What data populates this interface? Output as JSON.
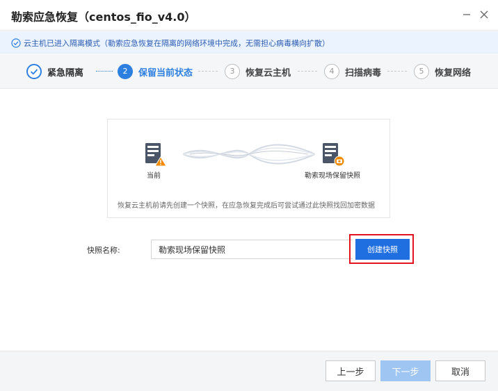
{
  "window": {
    "title": "勒索应急恢复（centos_fio_v4.0）"
  },
  "info_bar": {
    "text": "云主机已进入隔离模式（勒索应急恢复在隔离的网络环境中完成，无需担心病毒横向扩散）"
  },
  "steps": [
    {
      "number": "",
      "label": "紧急隔离",
      "state": "done"
    },
    {
      "number": "2",
      "label": "保留当前状态",
      "state": "active"
    },
    {
      "number": "3",
      "label": "恢复云主机",
      "state": "todo"
    },
    {
      "number": "4",
      "label": "扫描病毒",
      "state": "todo"
    },
    {
      "number": "5",
      "label": "恢复网络",
      "state": "todo"
    }
  ],
  "diagram": {
    "left_label": "当前",
    "right_label": "勒索现场保留快照",
    "description": "恢复云主机前请先创建一个快照，在应急恢复完成后可尝试通过此快照找回加密数据"
  },
  "form": {
    "snapshot_label": "快照名称:",
    "snapshot_value": "勒索现场保留快照",
    "create_button": "创建快照"
  },
  "footer": {
    "prev": "上一步",
    "next": "下一步",
    "cancel": "取消"
  },
  "colors": {
    "primary": "#1f6fe0",
    "step_active": "#2d7fe0",
    "info_bg": "#eaf3ff",
    "highlight": "#e3121e",
    "next_disabled": "#9fc5f2",
    "warning": "#f08a00"
  }
}
